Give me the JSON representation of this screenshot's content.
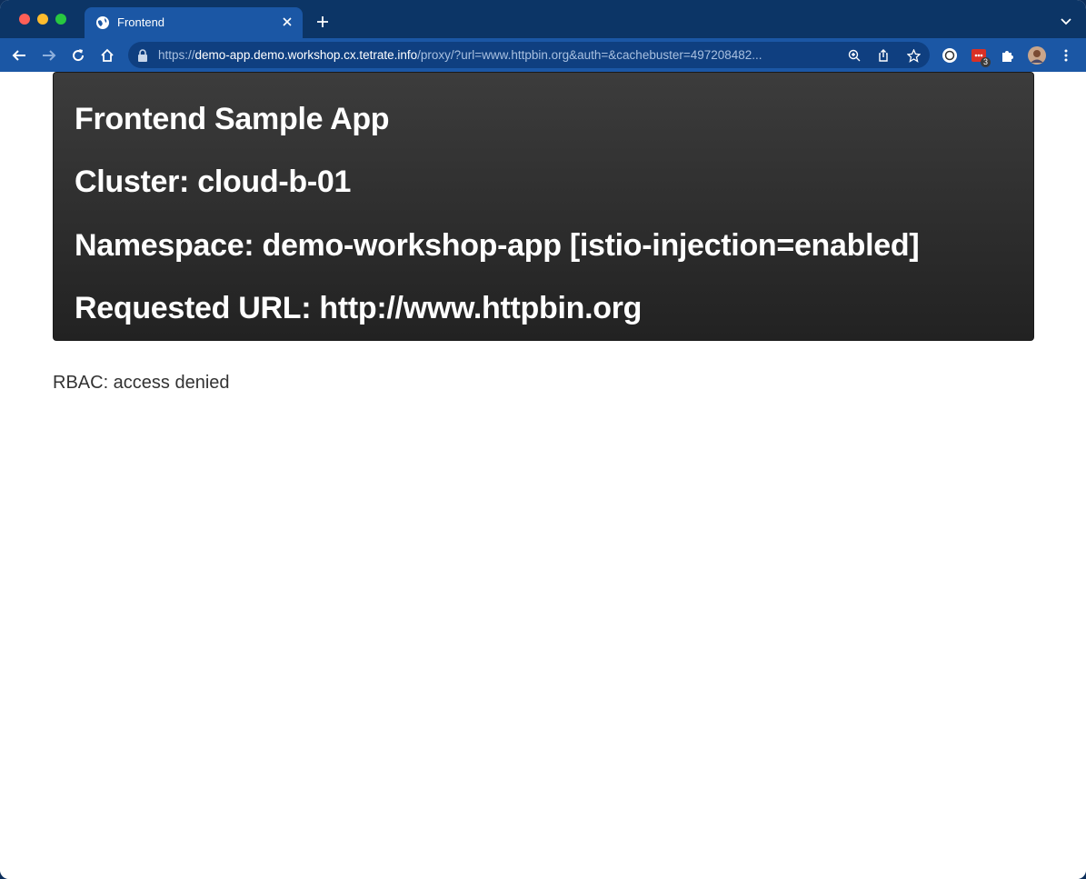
{
  "browser": {
    "tab_title": "Frontend",
    "url_scheme": "https://",
    "url_host": "demo-app.demo.workshop.cx.tetrate.info",
    "url_path": "/proxy/?url=www.httpbin.org&auth=&cachebuster=497208482...",
    "extension_badge": "3",
    "icons": {
      "close_tab": "close-icon",
      "new_tab": "plus-icon",
      "back": "back-arrow-icon",
      "forward": "forward-arrow-icon",
      "reload": "reload-icon",
      "home": "home-icon",
      "lock": "lock-icon",
      "zoom": "zoom-icon",
      "share": "share-icon",
      "bookmark": "star-icon",
      "extensions": "puzzle-icon",
      "menu": "kebab-menu-icon"
    },
    "colors": {
      "tabbar": "#0c3566",
      "toolbar": "#1b57a5",
      "omnibox": "#0f3f80"
    }
  },
  "page": {
    "heading_app": "Frontend Sample App",
    "heading_cluster": "Cluster: cloud-b-01",
    "heading_namespace": "Namespace: demo-workshop-app [istio-injection=enabled]",
    "heading_url": "Requested URL: http://www.httpbin.org",
    "message": "RBAC: access denied",
    "colors": {
      "hero_bg": "#2e2e2e",
      "hero_text": "#ffffff",
      "message_text": "#333333"
    }
  }
}
